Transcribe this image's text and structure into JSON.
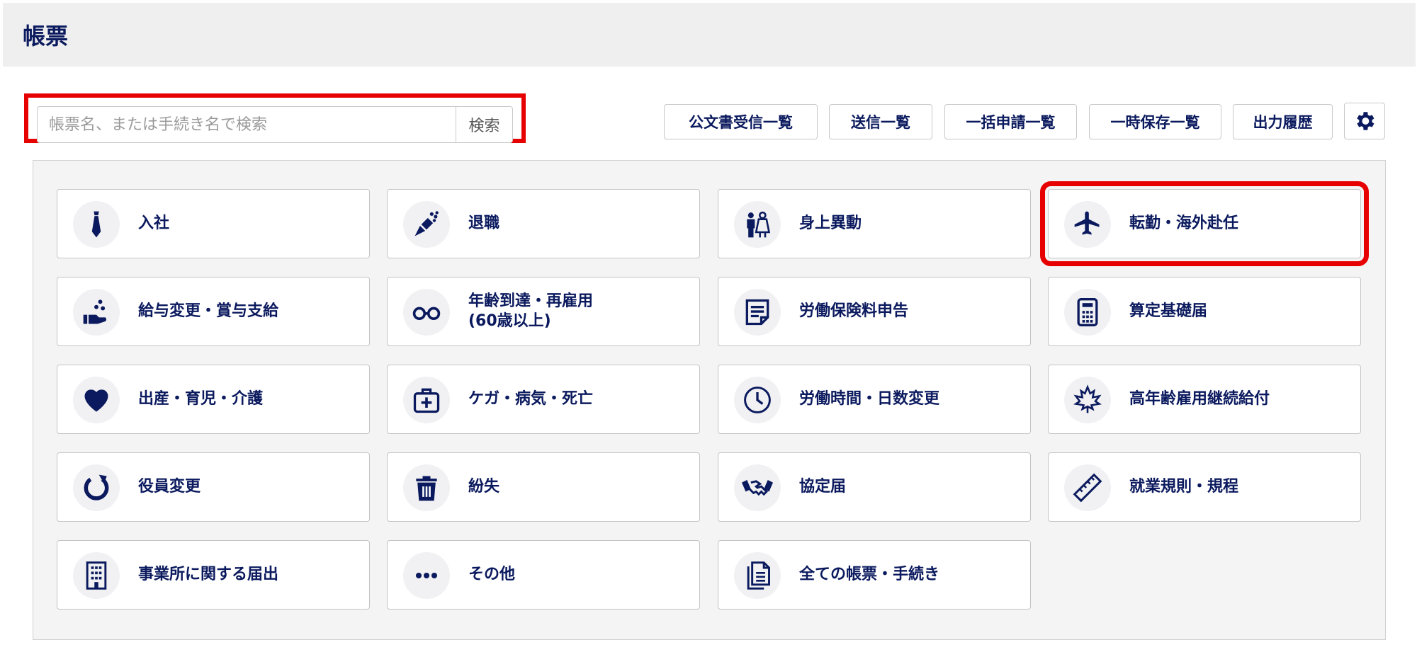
{
  "page": {
    "title": "帳票"
  },
  "search": {
    "placeholder": "帳票名、または手続き名で検索",
    "button_label": "検索"
  },
  "toolbar": {
    "buttons": [
      {
        "label": "公文書受信一覧"
      },
      {
        "label": "送信一覧"
      },
      {
        "label": "一括申請一覧"
      },
      {
        "label": "一時保存一覧"
      },
      {
        "label": "出力履歴"
      }
    ],
    "settings_icon": "gear-icon"
  },
  "colors": {
    "primary": "#0b1a5e",
    "highlight": "#e60000",
    "header_bg": "#efefef",
    "panel_bg": "#f4f4f4"
  },
  "tiles": [
    {
      "label": "入社",
      "icon": "necktie-icon"
    },
    {
      "label": "退職",
      "icon": "bouquet-icon"
    },
    {
      "label": "身上異動",
      "icon": "wedding-couple-icon"
    },
    {
      "label": "転勤・海外赴任",
      "icon": "airplane-icon"
    },
    {
      "label": "給与変更・賞与支給",
      "icon": "hand-coins-icon"
    },
    {
      "label": "年齢到達・再雇用",
      "label2": "(60歳以上)",
      "icon": "glasses-icon"
    },
    {
      "label": "労働保険料申告",
      "icon": "document-icon"
    },
    {
      "label": "算定基礎届",
      "icon": "calculator-icon"
    },
    {
      "label": "出産・育児・介護",
      "icon": "heart-icon"
    },
    {
      "label": "ケガ・病気・死亡",
      "icon": "first-aid-kit-icon"
    },
    {
      "label": "労働時間・日数変更",
      "icon": "clock-icon"
    },
    {
      "label": "高年齢雇用継続給付",
      "icon": "maple-leaf-icon"
    },
    {
      "label": "役員変更",
      "icon": "refresh-icon"
    },
    {
      "label": "紛失",
      "icon": "trash-icon"
    },
    {
      "label": "協定届",
      "icon": "handshake-icon"
    },
    {
      "label": "就業規則・規程",
      "icon": "ruler-icon"
    },
    {
      "label": "事業所に関する届出",
      "icon": "building-icon"
    },
    {
      "label": "その他",
      "icon": "ellipsis-icon"
    },
    {
      "label": "全ての帳票・手続き",
      "icon": "documents-icon"
    }
  ]
}
